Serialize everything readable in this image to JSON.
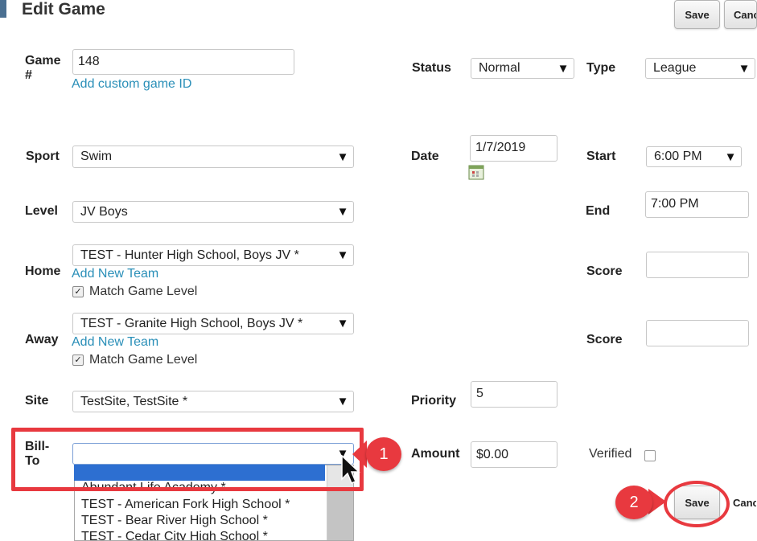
{
  "header": {
    "title": "Edit Game",
    "save_label": "Save",
    "cancel_label": "Canc"
  },
  "game_number": {
    "label": "Game #",
    "value": "148",
    "custom_id_link": "Add custom game ID"
  },
  "status": {
    "label": "Status",
    "value": "Normal"
  },
  "type": {
    "label": "Type",
    "value": "League"
  },
  "sport": {
    "label": "Sport",
    "value": "Swim"
  },
  "date": {
    "label": "Date",
    "value": "1/7/2019"
  },
  "start": {
    "label": "Start",
    "value": "6:00 PM"
  },
  "level": {
    "label": "Level",
    "value": "JV Boys"
  },
  "end": {
    "label": "End",
    "value": "7:00 PM"
  },
  "home": {
    "label": "Home",
    "value": "TEST - Hunter High School, Boys JV *",
    "add_team_link": "Add New Team",
    "match_level_label": "Match Game Level",
    "match_level_checked": true,
    "score_label": "Score",
    "score_value": ""
  },
  "away": {
    "label": "Away",
    "value": "TEST - Granite High School, Boys JV *",
    "add_team_link": "Add New Team",
    "match_level_label": "Match Game Level",
    "match_level_checked": true,
    "score_label": "Score",
    "score_value": ""
  },
  "site": {
    "label": "Site",
    "value": "TestSite, TestSite *"
  },
  "priority": {
    "label": "Priority",
    "value": "5"
  },
  "bill_to": {
    "label_line1": "Bill-",
    "label_line2": "To",
    "value": "",
    "options": [
      "Abundant Life Academy *",
      "TEST - American Fork High School *",
      "TEST - Bear River High School *",
      "TEST - Cedar City High School *"
    ]
  },
  "amount": {
    "label": "Amount",
    "value": "$0.00"
  },
  "verified": {
    "label": "Verified",
    "checked": false
  },
  "footer": {
    "save_label": "Save",
    "cancel_label": "Canc"
  },
  "callouts": {
    "one": "1",
    "two": "2"
  },
  "colors": {
    "accent_red": "#e8393f",
    "link": "#2a8fb8",
    "highlight": "#2d6fd1"
  }
}
